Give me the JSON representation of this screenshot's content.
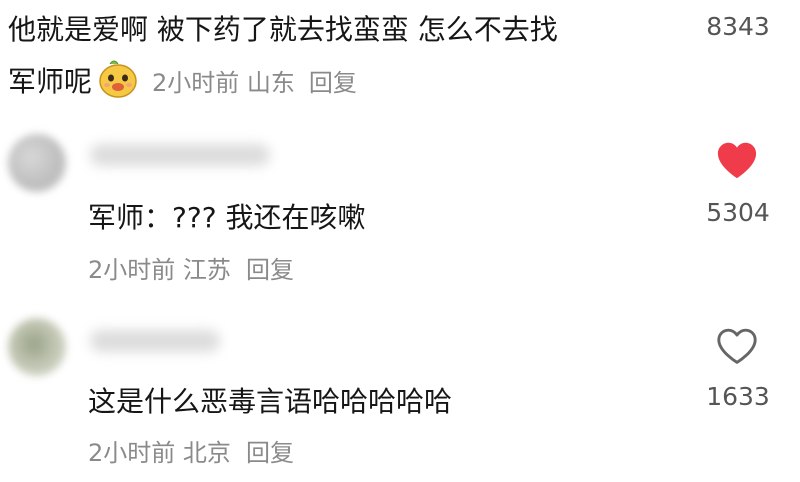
{
  "comments": [
    {
      "line1": "他就是爱啊 被下药了就去找蛮蛮 怎么不去找",
      "line2": "军师呢",
      "emoji": "doge-emoji",
      "time_loc": "2小时前 山东",
      "reply": "回复",
      "likes": "8343",
      "liked": false
    },
    {
      "text": "军师：???  我还在咳嗽",
      "time_loc": "2小时前 江苏",
      "reply": "回复",
      "likes": "5304",
      "liked": true
    },
    {
      "text": "这是什么恶毒言语哈哈哈哈哈",
      "time_loc": "2小时前 北京",
      "reply": "回复",
      "likes": "1633",
      "liked": false
    }
  ],
  "colors": {
    "like_active": "#ef3b4a",
    "meta": "#8a8a8a"
  }
}
